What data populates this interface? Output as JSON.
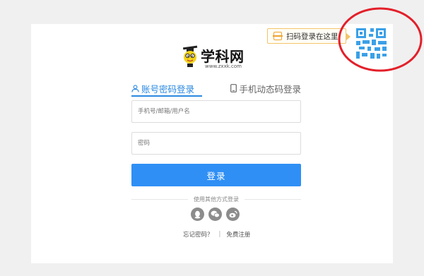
{
  "qr": {
    "tip_label": "扫码登录在这里"
  },
  "logo": {
    "name": "学科网",
    "url": "www.zxxk.com"
  },
  "tabs": [
    {
      "label": "账号密码登录",
      "active": true
    },
    {
      "label": "手机动态码登录",
      "active": false
    }
  ],
  "form": {
    "username_placeholder": "手机号/邮箱/用户名",
    "password_placeholder": "密码",
    "login_label": "登录"
  },
  "other_login": {
    "label": "使用其他方式登录",
    "providers": [
      "qq-icon",
      "wechat-icon",
      "weibo-icon"
    ]
  },
  "footer": {
    "forgot_label": "忘记密码？",
    "separator": "|",
    "register_label": "免费注册"
  },
  "colors": {
    "accent": "#2f8ff5",
    "tab_active": "#2a88e0",
    "qr_blue": "#3aa0e8",
    "annotation_red": "#e3202a",
    "tip_border": "#f3c46b"
  }
}
